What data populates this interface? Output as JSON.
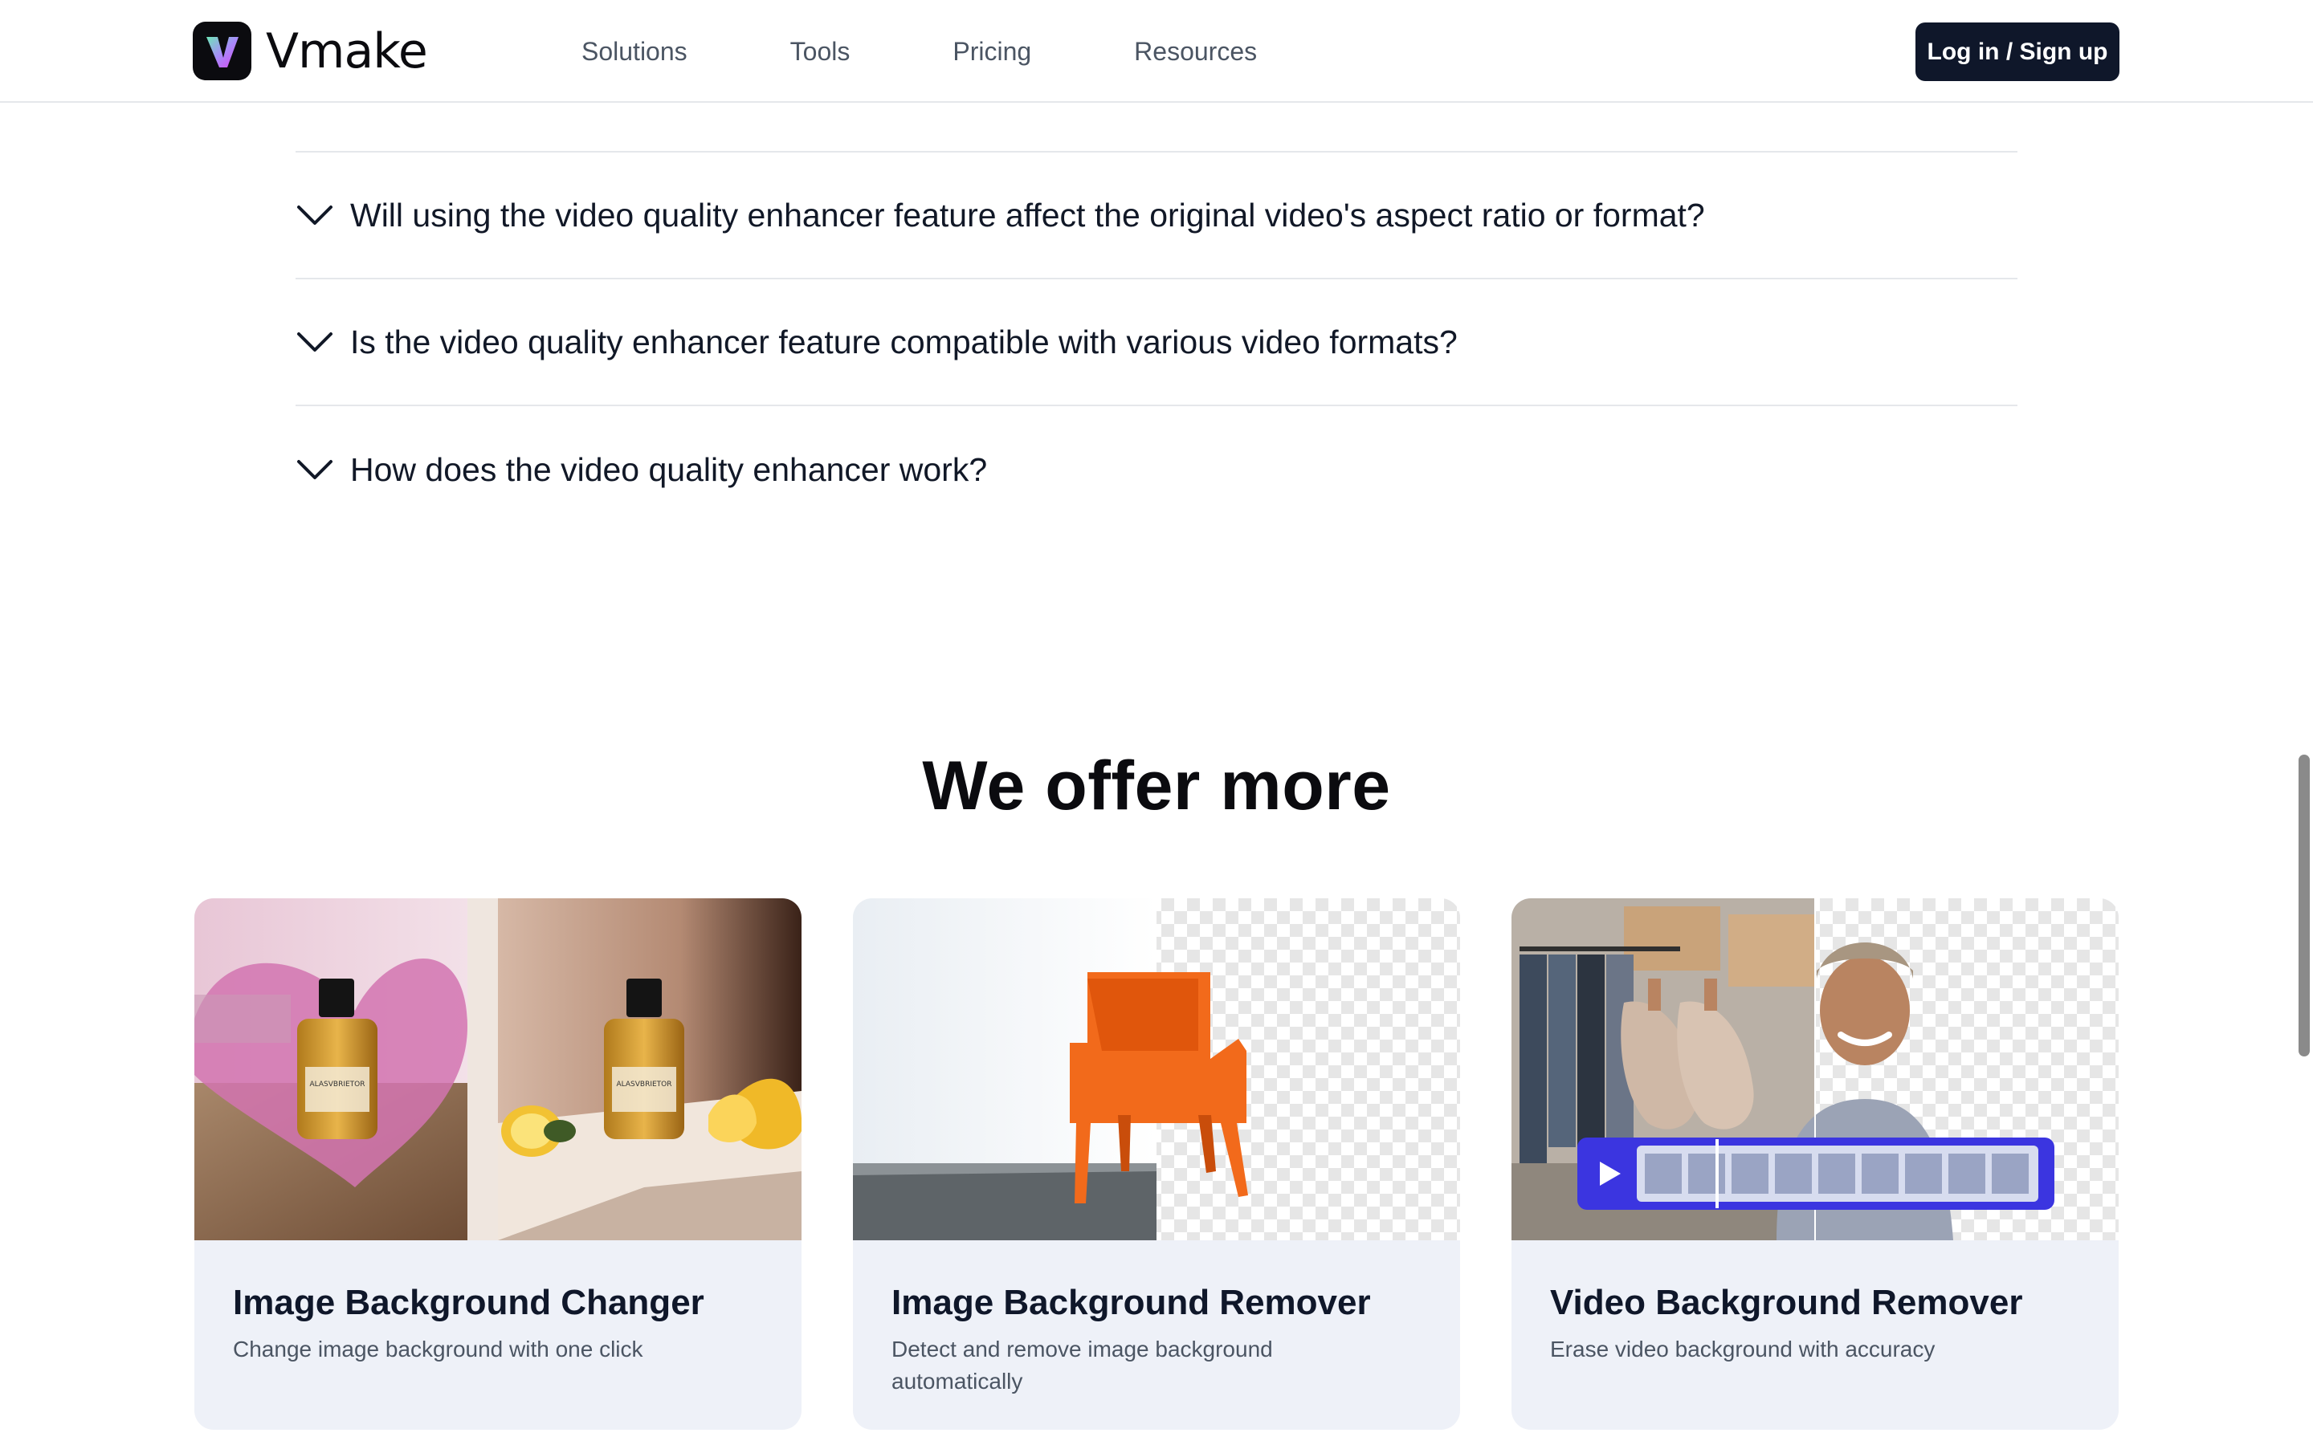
{
  "header": {
    "brand": "Vmake",
    "nav": [
      "Solutions",
      "Tools",
      "Pricing",
      "Resources"
    ],
    "login_label": "Log in / Sign up"
  },
  "faq": {
    "questions": [
      "Will using the video quality enhancer feature affect the original video's aspect ratio or format?",
      "Is the video quality enhancer feature compatible with various video formats?",
      "How does the video quality enhancer work?"
    ],
    "chevron_icon": "chevron-down-icon"
  },
  "offer": {
    "title": "We offer more",
    "cards": [
      {
        "title": "Image Background Changer",
        "desc": "Change image background with one click",
        "product_label": "ALASVBRIETOR"
      },
      {
        "title": "Image Background Remover",
        "desc": "Detect and remove image background automatically"
      },
      {
        "title": "Video Background Remover",
        "desc": "Erase video background with accuracy",
        "play_icon": "play-icon"
      }
    ]
  },
  "colors": {
    "accent": "#0f172a",
    "card_bg": "#eef1f8",
    "video_bar": "#3b35e0",
    "chair": "#f26a1b",
    "logo_gradient": [
      "#4ade80",
      "#a855f7"
    ]
  }
}
